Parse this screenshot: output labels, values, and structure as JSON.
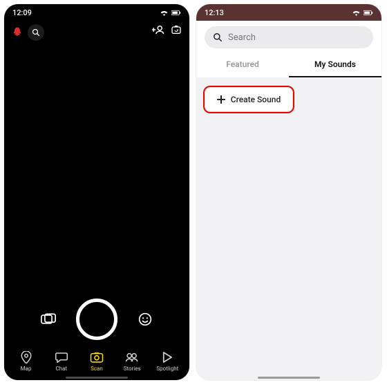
{
  "left": {
    "status": {
      "time": "12:09"
    },
    "nav": {
      "map": "Map",
      "chat": "Chat",
      "scan": "Scan",
      "stories": "Stories",
      "spotlight": "Spotlight"
    }
  },
  "right": {
    "status": {
      "time": "12:13"
    },
    "search": {
      "placeholder": "Search"
    },
    "tabs": {
      "featured": "Featured",
      "mysounds": "My Sounds"
    },
    "create_label": "Create Sound"
  }
}
